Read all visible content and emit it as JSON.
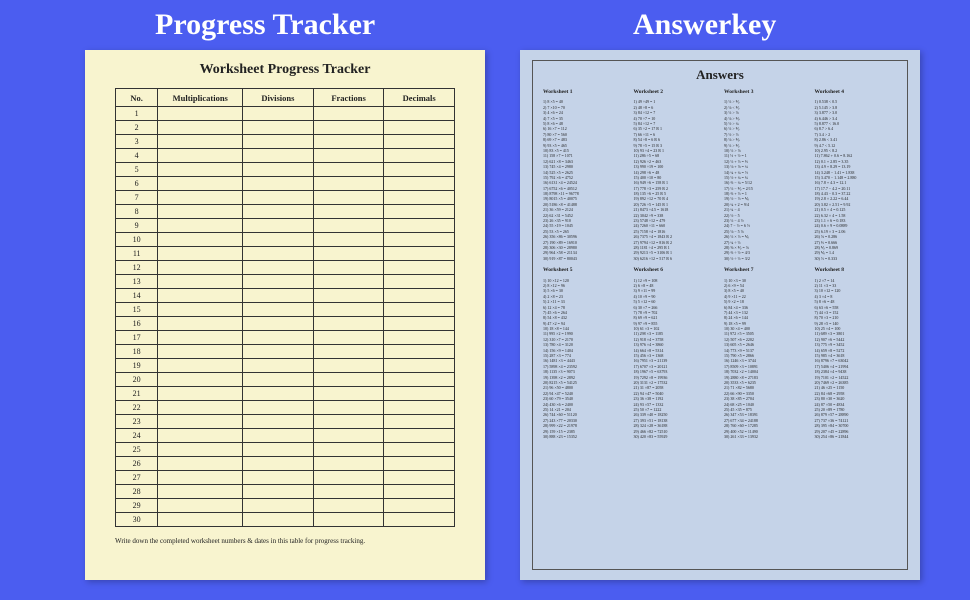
{
  "headings": {
    "left": "Progress Tracker",
    "right": "Answerkey"
  },
  "tracker": {
    "title": "Worksheet Progress Tracker",
    "columns": [
      "No.",
      "Multiplications",
      "Divisions",
      "Fractions",
      "Decimals"
    ],
    "rows": [
      "1",
      "2",
      "3",
      "4",
      "5",
      "6",
      "7",
      "8",
      "9",
      "10",
      "11",
      "12",
      "13",
      "14",
      "15",
      "16",
      "17",
      "18",
      "19",
      "20",
      "21",
      "22",
      "23",
      "24",
      "25",
      "26",
      "27",
      "28",
      "29",
      "30"
    ],
    "footer": "Write down the completed worksheet numbers & dates in this table for progress tracking."
  },
  "answers": {
    "title": "Answers",
    "worksheets": [
      {
        "name": "Worksheet 1",
        "lines": [
          "1) 8 ×5 = 40",
          "2) 7 ×10 = 70",
          "3) 4 ×6 = 24",
          "4) 7 ×5 = 35",
          "5) 8 ×6 = 48",
          "6) 16 ×7 = 112",
          "7) 80 ×7 = 560",
          "8) 69 ×7 = 483",
          "9) 93 ×5 = 465",
          "10) 83 ×5 = 415",
          "11) 158 ×7 = 1071",
          "12) 621 ×8 = 3463",
          "13) 745 ×4 = 2980",
          "14) 525 ×5 = 2625",
          "15) 792 ×6 = 4752",
          "16) 6131 ×4 = 24524",
          "17) 6752 ×6 = 40512",
          "18) 8798 ×11 = 96778",
          "19) 8015 ×5 = 40075",
          "20) 5186 ×8 = 41488",
          "21) 36 ×59 = 2124",
          "22) 62 ×31 = 5452",
          "23) 26 ×35 = 910",
          "24) 55 ×19 = 1045",
          "25) 53 ×5 = 265",
          "26) 356 ×86 = 30596",
          "27) 190 ×89 = 16910",
          "28) 306 ×30 = 28980",
          "29) 964 ×58 = 21134",
          "30) 919 ×87 = 80043"
        ]
      },
      {
        "name": "Worksheet 2",
        "lines": [
          "1) 49 ÷49 = 1",
          "2) 48 ÷8 = 6",
          "3) 84 ÷12 = 7",
          "4) 70 ÷7 = 10",
          "5) 84 ÷12 = 7",
          "6) 35 ÷2 = 17 R 1",
          "7) 66 ÷11 = 6",
          "8) 54 ÷8 = 6 R 6",
          "9) 78 ÷5 = 15 R 3",
          "10) 93 ÷4 = 23 R 1",
          "11) 286 ÷5 = 68",
          "12) 926 ÷2 = 463",
          "13) 990 ÷19 = 100",
          "14) 298 ÷6 = 48",
          "15) 400 ÷10 = 80",
          "16) 949 ÷6 = 158 R 1",
          "17) 778 ÷3 = 259 R 2",
          "18) 135 ÷6 = 25 R 5",
          "19) 892 ÷12 = 70 R 4",
          "20) 726 ÷5 = 145 R 1",
          "21) 8473 ÷4.5 = 1618",
          "22) 3042 ÷9 = 338",
          "23) 5748 ÷12 = 479",
          "24) 7260 ÷11 = 660",
          "25) 7158 ÷4 = 1816",
          "26) 7375 ÷4 = 1843 R 2",
          "27) 9794 ÷12 = 816 R 2",
          "28) 1181 ÷4 = 295 R 1",
          "29) 9213 ÷5 = 3106 R 1",
          "30) 6216 ÷12 = 517 R 6"
        ]
      },
      {
        "name": "Worksheet 3",
        "lines": [
          "1) ⅓ > ⅕",
          "2) ⅛ < ⅕",
          "3) ⅓ > ⅛",
          "4) ⅛ > ⅑",
          "5) ½ > ¼",
          "6) ⅓ > ⅕",
          "7) ½ > ⅓",
          "8) ⅛ > ⅑",
          "9) ⅓ > ⅕",
          "10) ⅓ > ⅛",
          "11) ½ + ½ = 1",
          "12) ⅓ + ⅓ = ⅔",
          "13) ⅛ + ⅛ = ¼",
          "14) ¼ + ¼ = ½",
          "15) ½ + ¼ = ¾",
          "16) ⅔ − ¼ = 5/12",
          "17) ⅓ − ⅕ = 2/15",
          "18) ⅔ + ⅓ = 1",
          "19) ½ − ⅓ = ⅙",
          "20) ¼ + 2 = 9/4",
          "21) ¼ − 4",
          "22) ½ − 5",
          "23) ⅓ − 4 ½",
          "24) 7 − ½ = 6 ½",
          "25) ⅛ − 5 ⅛",
          "26) ⅓ × ⅓ = ⅙",
          "27) ¼ ÷ ⅓",
          "28) ⅝ × ⅕ = ⅛",
          "29) ⅔ ÷ ½ = 4/3",
          "30) ½ ÷ ⅓ = 3/2"
        ]
      },
      {
        "name": "Worksheet 4",
        "lines": [
          "1) 0.538 < 0.5",
          "2) 5.145 > 3.8",
          "3) 3.877 > 3.0",
          "4) 6.446 > 3.4",
          "5) 8.877 < 16.0",
          "6) 8.7 > 6.4",
          "7) 3.4 > 2",
          "8) 2.86 < 3.41",
          "9) 4.7 < 5.12",
          "10) 2.95 < 8.2",
          "11) 7.862 + 0.6 = 8.162",
          "12) 0.1 + 2.85 = 3.35",
          "13) 4.9 + 8.29 = 13.19",
          "14) 3.248 − 1.41 = 1.838",
          "15) 3.470 − 1.148 = 2.880",
          "16) 7.8 + 4.3 = 12.1",
          "17) 17.7 − 4.2 = 20.11",
          "18) 4.43 − 0.3 = 37.22",
          "19) 2.8 × 2.22 = 6.44",
          "20) 3.82 × 2.51 = 9.92",
          "21) 0.5 × 4 = 0.125",
          "22) 6.32 × 4 = 1.58",
          "23) 1.1 × 6 = 0.183",
          "24) 0.6 × 9 = 0.0889",
          "25) 6.19 × 3 = 2.06",
          "26) ⅛ = 0.286",
          "27) ⅔ = 0.666",
          "28) ⅕ = 0.869",
          "29) ⅙ = 1.4",
          "30) ⅓ = 0.333"
        ]
      },
      {
        "name": "Worksheet 5",
        "lines": [
          "1) 10 ×12 = 120",
          "2) 8 ×12 = 96",
          "3) 5 ×6 = 30",
          "4) 2 ×8 = 23",
          "5) 2 ×11 = 33",
          "6) 12 ×4 = 78",
          "7) 45 ×6 = 264",
          "8) 54 ×8 = 432",
          "9) 47 ×2 = 94",
          "10) 18 ×8 = 144",
          "11) 995 ×2 = 1990",
          "12) 310 ×7 = 2170",
          "13) 780 ×4 = 3120",
          "14) 156 ×9 = 1404",
          "15) 287 ×3 = 774",
          "16) 1481 ×3 = 4443",
          "17) 5898 ×4 = 23592",
          "18) 1135 ×3 = 9073",
          "19) 1398 ×2 = 2892",
          "20) 8215 ×5 = 54125",
          "21) 96 ×50 = 4800",
          "22) 94 ×47 = 5240",
          "23) 60 ×79 = 3540",
          "24) 430 ×6 = 2400",
          "25) 14 ×21 = 204",
          "26) 744 ×60 = 51120",
          "27) 243 ×77 = 20330",
          "28) 999 ×22 = 21978",
          "29) 159 ×15 = 2385",
          "30) 888 ×23 = 15352"
        ]
      },
      {
        "name": "Worksheet 6",
        "lines": [
          "1) 12 ×9 = 108",
          "2) 6 ×8 = 48",
          "3) 9 ×11 = 99",
          "4) 10 ×9 = 90",
          "5) 5 ×12 = 60",
          "6) 30 ×7 = 266",
          "7) 78 ×9 = 702",
          "8) 69 ×9 = 621",
          "9) 97 ×9 = 855",
          "10) 61 ×3 = 102",
          "11) 298 ×3 = 1185",
          "12) 918 ×4 = 3758",
          "13) 976 ×4 = 3860",
          "14) 664 ×8 = 5314",
          "15) 456 ×3 = 1368",
          "16) 7951 ×3 = 21139",
          "17) 6707 ×3 = 20121",
          "18) 1967 ×5 = 63793",
          "19) 7292 ×8 = 19936",
          "20) 3131 ×2 = 17532",
          "21) 31 ×87 = 2058",
          "22) 94 ×47 = 5040",
          "23) 36 ×38 = 1192",
          "24) 93 ×57 = 1332",
          "25) 50 ×7 = 1222",
          "26) 339 ×40 = 18250",
          "27) 393 ×51 = 18138",
          "28) 324 ×28 = 36188",
          "29) 466 ×82 = 72510",
          "30) 420 ×83 = 55929"
        ]
      },
      {
        "name": "Worksheet 7",
        "lines": [
          "1) 10 ×3 = 30",
          "2) 6 ×9 = 54",
          "3) 8 ×5 = 40",
          "4) 9 ×11 = 22",
          "5) 9 ×2 = 18",
          "6) 84 ×4 = 336",
          "7) 44 ×3 = 132",
          "8) 24 ×6 = 144",
          "9) 18 ×5 = 99",
          "10) 30 ×4 = 400",
          "11) 972 ×5 = 3505",
          "12) 507 ×6 = 2202",
          "13) 605 ×5 = 2646",
          "14) 773 ×9 = 5137",
          "15) 790 ×5 = 2866",
          "16) 1246 ×3 = 3744",
          "17) 8509 ×3 = 10891",
          "18) 7032 ×2 = 14004",
          "19) 2880 ×8 = 27183",
          "20) 3533 ×5 = 6235",
          "21) 71 ×82 = 5680",
          "22) 66 ×90 = 3350",
          "23) 38 ×85 = 2704",
          "24) 68 ×25 = 1040",
          "25) 45 ×35 = 875",
          "26) 347 ×53 = 18391",
          "27) 677 ×34 = 24188",
          "28) 760 ×60 = 17285",
          "29) 400 ×52 = 11490",
          "30) 261 ×33 = 13932"
        ]
      },
      {
        "name": "Worksheet 8",
        "lines": [
          "1) 2 ×7 = 14",
          "2) 11 ×3 = 33",
          "3) 10 ×12 = 120",
          "4) 3 ×4 = 8",
          "5) 8 ×6 = 48",
          "6) 63 ×6 = 558",
          "7) 44 ×3 = 152",
          "8) 70 ×3 = 210",
          "9) 28 ×5 = 140",
          "10) 25 ×4 = 100",
          "11) 689 ×3 = 3801",
          "12) 907 ×6 = 5442",
          "13) 775 ×9 = 3452",
          "14) 659 ×8 = 5272",
          "15) 985 ×4 = 3618",
          "16) 8796 ×7 = 63042",
          "17) 5406 ×4 = 21994",
          "18) 2384 ×4 = 9438",
          "19) 7101 ×2 = 14522",
          "20) 7469 ×2 = 26385",
          "21) 46 ×25 = 1150",
          "22) 84 ×68 = 2958",
          "23) 80 ×30 = 3620",
          "24) 87 ×50 = 4834",
          "25) 20 ×89 = 1780",
          "26) 879 ×57 = 28890",
          "27) 737 ×36 = 74121",
          "28) 395 ×84 = 30700",
          "29) 207 ×45 = 22896",
          "30) 254 ×86 = 21844"
        ]
      }
    ]
  }
}
